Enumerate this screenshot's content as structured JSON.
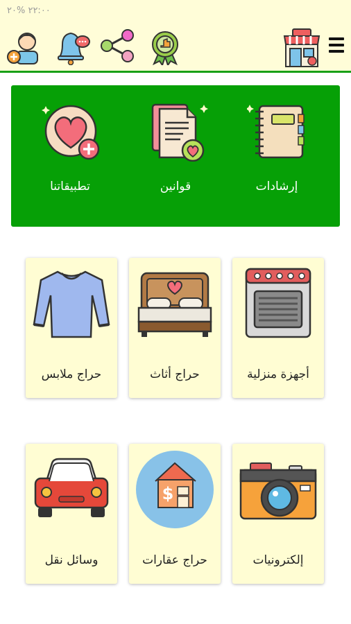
{
  "status_bar": {
    "text": "٢٢:٠٠ %٢٠"
  },
  "app_bar": {
    "icons": [
      "profile-add-icon",
      "notification-bell-icon",
      "share-icon",
      "award-badge-icon",
      "store-icon",
      "menu-icon"
    ]
  },
  "top_actions": [
    {
      "label": "تطبيقاتنا",
      "icon": "heart-plus-icon"
    },
    {
      "label": "قوانين",
      "icon": "document-heart-icon"
    },
    {
      "label": "إرشادات",
      "icon": "notebook-icon"
    }
  ],
  "categories": [
    {
      "label": "حراج ملابس",
      "icon": "shirt-icon"
    },
    {
      "label": "حراج أثاث",
      "icon": "bed-icon"
    },
    {
      "label": "أجهزة منزلية",
      "icon": "oven-icon"
    },
    {
      "label": "وسائل نقل",
      "icon": "car-icon"
    },
    {
      "label": "حراج عقارات",
      "icon": "house-icon"
    },
    {
      "label": "إلكترونيات",
      "icon": "camera-icon"
    }
  ],
  "colors": {
    "accent_green": "#06a006",
    "card_bg": "#fffdd3",
    "bar_bg": "#fffdd8"
  }
}
